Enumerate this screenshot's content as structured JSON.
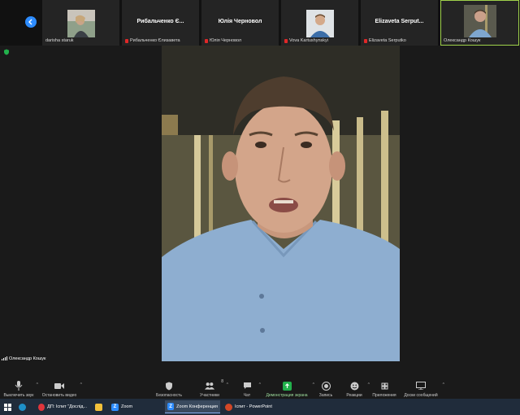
{
  "participants": [
    {
      "label": "darisha staruk",
      "muted": false,
      "kind": "photo"
    },
    {
      "label": "Рибальченко Єлизавета",
      "tile_name": "Рибальченко Є...",
      "muted": true,
      "kind": "name"
    },
    {
      "label": "Юлія Черновол",
      "tile_name": "Юлія Черновол",
      "muted": true,
      "kind": "name"
    },
    {
      "label": "Vova Kartushynskyi",
      "muted": true,
      "kind": "photo"
    },
    {
      "label": "Elizaveta Serputko",
      "tile_name": "Elizaveta Serput...",
      "muted": true,
      "kind": "name"
    },
    {
      "label": "Олександр Кошук",
      "muted": false,
      "kind": "photo",
      "active": true
    }
  ],
  "speaker": {
    "name": "Олександр Кошук"
  },
  "controls": {
    "mute": "Выключить звук",
    "video": "Остановить видео",
    "security": "Безопасность",
    "participants": "Участники",
    "participants_count": "8",
    "chat": "Чат",
    "share": "Демонстрация экрана",
    "record": "Запись",
    "reactions": "Реакции",
    "apps": "Приложения",
    "whiteboards": "Доски сообщений"
  },
  "taskbar": {
    "items": [
      {
        "label": "ДП: Іспит \"Дослід...",
        "icon": "opera-icon"
      },
      {
        "label": "",
        "icon": "folder-icon"
      },
      {
        "label": "Zoom",
        "icon": "zoom-icon"
      },
      {
        "label": "Zoom Конференция",
        "icon": "zoom-icon",
        "active": true
      },
      {
        "label": "Іспит - PowerPoint",
        "icon": "powerpoint-icon"
      }
    ]
  },
  "colors": {
    "accent": "#2d8cff",
    "active_border": "#9fd14b",
    "share": "#22b14c",
    "muted": "#e02828"
  }
}
